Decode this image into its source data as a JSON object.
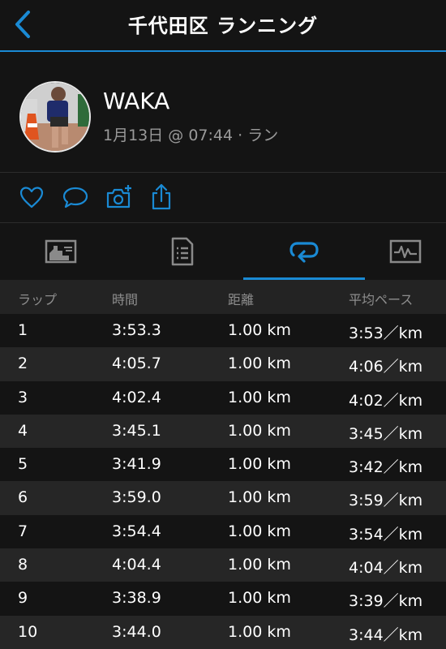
{
  "header": {
    "title": "千代田区 ランニング"
  },
  "profile": {
    "name": "WAKA",
    "meta": "1月13日 @ 07:44 · ラン"
  },
  "actions": {
    "icons": [
      "heart-icon",
      "comment-icon",
      "camera-add-icon",
      "share-icon"
    ]
  },
  "tabs": {
    "items": [
      "summary-chart-icon",
      "details-list-icon",
      "laps-icon",
      "graph-icon"
    ],
    "active_index": 2
  },
  "laps_table": {
    "headers": [
      "ラップ",
      "時間",
      "距離",
      "平均ペース"
    ],
    "rows": [
      [
        "1",
        "3:53.3",
        "1.00 km",
        "3:53／km"
      ],
      [
        "2",
        "4:05.7",
        "1.00 km",
        "4:06／km"
      ],
      [
        "3",
        "4:02.4",
        "1.00 km",
        "4:02／km"
      ],
      [
        "4",
        "3:45.1",
        "1.00 km",
        "3:45／km"
      ],
      [
        "5",
        "3:41.9",
        "1.00 km",
        "3:42／km"
      ],
      [
        "6",
        "3:59.0",
        "1.00 km",
        "3:59／km"
      ],
      [
        "7",
        "3:54.4",
        "1.00 km",
        "3:54／km"
      ],
      [
        "8",
        "4:04.4",
        "1.00 km",
        "4:04／km"
      ],
      [
        "9",
        "3:38.9",
        "1.00 km",
        "3:39／km"
      ],
      [
        "10",
        "3:44.0",
        "1.00 km",
        "3:44／km"
      ]
    ]
  },
  "colors": {
    "accent": "#1a8ad4",
    "background": "#141414",
    "row_alt": "#262626",
    "header_row": "#232323",
    "muted_text": "#9a9a9a"
  }
}
